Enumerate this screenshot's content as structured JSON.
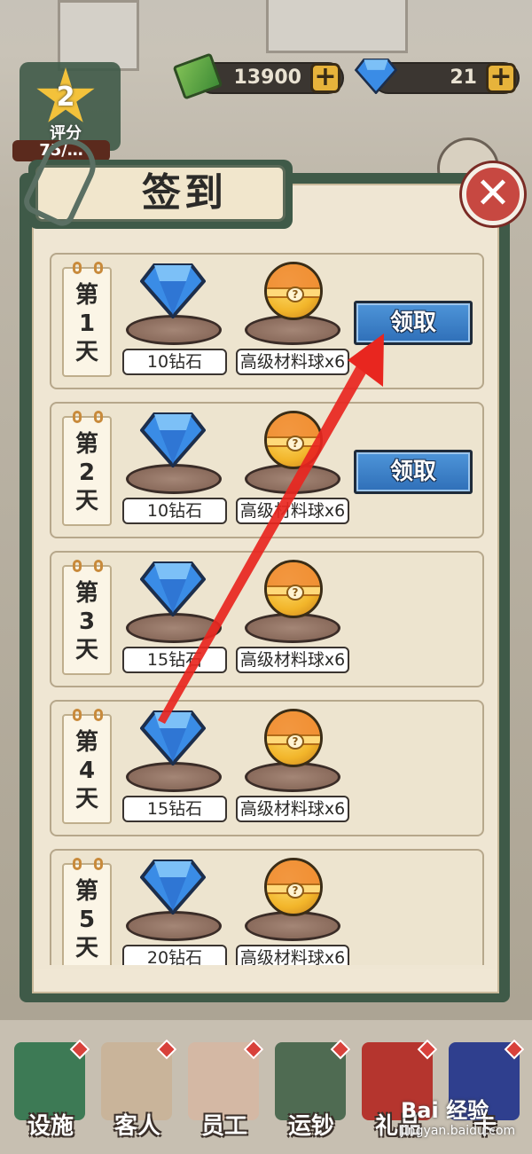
{
  "header": {
    "cash_amount": "13900",
    "gem_amount": "21",
    "plus_symbol": "+",
    "rating": {
      "level": "2",
      "label": "评分",
      "progress": "75/…"
    }
  },
  "dialog": {
    "title": "签到",
    "close_symbol": "✕",
    "days": [
      {
        "day_prefix": "第",
        "day_number": "1",
        "day_suffix": "天",
        "gem_reward": "10钻石",
        "item_reward": "高级材料球x6",
        "claim_label": "领取"
      },
      {
        "day_prefix": "第",
        "day_number": "2",
        "day_suffix": "天",
        "gem_reward": "10钻石",
        "item_reward": "高级材料球x6",
        "claim_label": "领取"
      },
      {
        "day_prefix": "第",
        "day_number": "3",
        "day_suffix": "天",
        "gem_reward": "15钻石",
        "item_reward": "高级材料球x6"
      },
      {
        "day_prefix": "第",
        "day_number": "4",
        "day_suffix": "天",
        "gem_reward": "15钻石",
        "item_reward": "高级材料球x6"
      },
      {
        "day_prefix": "第",
        "day_number": "5",
        "day_suffix": "天",
        "gem_reward": "20钻石",
        "item_reward": "高级材料球x6"
      }
    ]
  },
  "bottom_nav": {
    "items": [
      {
        "label": "设施",
        "icon": "atm-icon"
      },
      {
        "label": "客人",
        "icon": "customers-icon"
      },
      {
        "label": "员工",
        "icon": "staff-icon"
      },
      {
        "label": "运钞",
        "icon": "cash-truck-icon"
      },
      {
        "label": "礼品",
        "icon": "gift-bag-icon"
      },
      {
        "label": "卡",
        "icon": "bank-card-icon"
      }
    ]
  },
  "watermark": {
    "brand": "Bai 经验",
    "url": "jingyan.baidu.com"
  },
  "colors": {
    "claim_blue": "#3a80c9",
    "close_red": "#c74841",
    "dialog_green": "#3f5a48",
    "paper": "#f0e7d4",
    "arrow_red": "#e8261f"
  }
}
